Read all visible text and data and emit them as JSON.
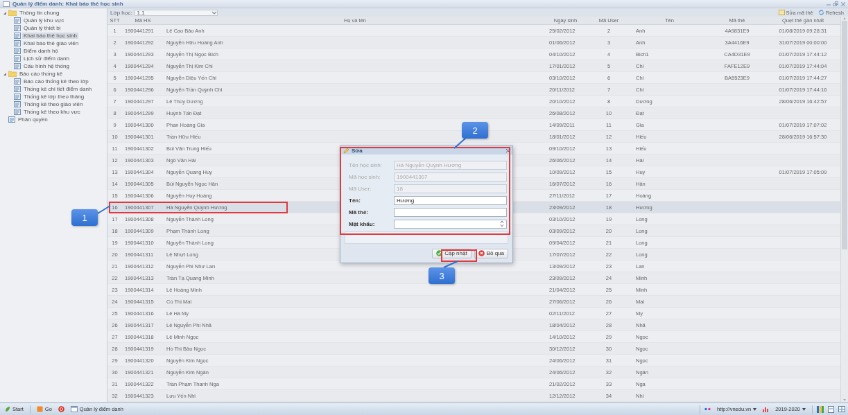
{
  "window": {
    "title": "Quản lý điểm danh: Khai báo thẻ học sinh"
  },
  "sidebar": {
    "items": [
      {
        "label": "Thông tin chung",
        "expanded": true,
        "children": [
          {
            "label": "Quản lý khu vực",
            "selected": false
          },
          {
            "label": "Quản lý thiết bị",
            "selected": false
          },
          {
            "label": "Khai báo thẻ học sinh",
            "selected": true
          },
          {
            "label": "Khai báo thẻ giáo viên",
            "selected": false
          },
          {
            "label": "Điểm danh hộ",
            "selected": false
          },
          {
            "label": "Lịch sử điểm danh",
            "selected": false
          },
          {
            "label": "Cấu hình hệ thống",
            "selected": false
          }
        ]
      },
      {
        "label": "Báo cáo thống kê",
        "expanded": true,
        "children": [
          {
            "label": "Báo cáo thống kê theo lớp",
            "selected": false
          },
          {
            "label": "Thống kê chi tiết điểm danh",
            "selected": false
          },
          {
            "label": "Thống kê lớp theo tháng",
            "selected": false
          },
          {
            "label": "Thống kê theo giáo viên",
            "selected": false
          },
          {
            "label": "Thống kê theo khu vực",
            "selected": false
          }
        ]
      },
      {
        "label": "Phân quyền",
        "selected": false
      }
    ]
  },
  "toolbar": {
    "class_label": "Lớp học:",
    "class_value": "1.1",
    "buttons": [
      {
        "label": "Sửa mã thẻ",
        "kind": "edit"
      },
      {
        "label": "Refresh",
        "kind": "refresh"
      }
    ]
  },
  "table": {
    "columns": [
      "STT",
      "Mã HS",
      "Họ và tên",
      "Ngày sinh",
      "Mã User",
      "Tên",
      "Mã thẻ",
      "Quẹt thẻ gần nhất"
    ],
    "rows": [
      {
        "selected": false,
        "stt": "1",
        "ma_hs": "1900441291",
        "ho_ten": "Lê Cao Bảo Anh",
        "ngay_sinh": "25/02/2012",
        "ma_user": "2",
        "ten": "Anh",
        "ma_the": "4A9831E9",
        "quet": "01/08/2019 09:28:31"
      },
      {
        "selected": false,
        "stt": "2",
        "ma_hs": "1900441292",
        "ho_ten": "Nguyễn Hữu Hoàng Anh",
        "ngay_sinh": "01/06/2012",
        "ma_user": "3",
        "ten": "Anh",
        "ma_the": "3A4416E9",
        "quet": "31/07/2019 00:00:00"
      },
      {
        "selected": false,
        "stt": "3",
        "ma_hs": "1900441293",
        "ho_ten": "Nguyễn Thị Ngọc Bích",
        "ngay_sinh": "04/10/2012",
        "ma_user": "4",
        "ten": "Bich1",
        "ma_the": "CA4D31E9",
        "quet": "01/07/2019 17:44:12"
      },
      {
        "selected": false,
        "stt": "4",
        "ma_hs": "1900441294",
        "ho_ten": "Nguyễn Thị Kim Chi",
        "ngay_sinh": "17/01/2012",
        "ma_user": "5",
        "ten": "Chi",
        "ma_the": "FAFE12E9",
        "quet": "01/07/2019 17:44:04"
      },
      {
        "selected": false,
        "stt": "5",
        "ma_hs": "1900441295",
        "ho_ten": "Nguyễn Diệu Yến Chi",
        "ngay_sinh": "03/10/2012",
        "ma_user": "6",
        "ten": "Chi",
        "ma_the": "BA5523E9",
        "quet": "01/07/2019 17:44:27"
      },
      {
        "selected": false,
        "stt": "6",
        "ma_hs": "1900441296",
        "ho_ten": "Nguyễn Trần Quỳnh Chi",
        "ngay_sinh": "20/11/2012",
        "ma_user": "7",
        "ten": "Chi",
        "quet": "01/07/2019 17:44:16"
      },
      {
        "selected": false,
        "stt": "7",
        "ma_hs": "1900441297",
        "ho_ten": "Lê Thùy Dương",
        "ngay_sinh": "20/10/2012",
        "ma_user": "8",
        "ten": "Dương",
        "quet": "28/06/2019 16:42:57"
      },
      {
        "selected": false,
        "stt": "8",
        "ma_hs": "1900441299",
        "ho_ten": "Huỳnh Tấn Đạt",
        "ngay_sinh": "26/08/2012",
        "ma_user": "10",
        "ten": "Đạt"
      },
      {
        "selected": false,
        "stt": "9",
        "ma_hs": "1900441300",
        "ho_ten": "Phan Hoàng Gia",
        "ngay_sinh": "14/09/2011",
        "ma_user": "11",
        "ten": "Gia",
        "quet": "01/07/2019 17:07:02"
      },
      {
        "selected": false,
        "stt": "10",
        "ma_hs": "1900441301",
        "ho_ten": "Trần Hữu Hiếu",
        "ngay_sinh": "18/01/2012",
        "ma_user": "12",
        "ten": "Hiếu",
        "quet": "28/06/2019 16:57:30"
      },
      {
        "selected": false,
        "stt": "11",
        "ma_hs": "1900441302",
        "ho_ten": "Bùi Văn Trung Hiếu",
        "ngay_sinh": "09/10/2012",
        "ma_user": "13",
        "ten": "Hiếu"
      },
      {
        "selected": false,
        "stt": "12",
        "ma_hs": "1900441303",
        "ho_ten": "Ngô Văn Hải",
        "ngay_sinh": "26/06/2012",
        "ma_user": "14",
        "ten": "Hải"
      },
      {
        "selected": false,
        "stt": "13",
        "ma_hs": "1900441304",
        "ho_ten": "Nguyễn Quang Huy",
        "ngay_sinh": "10/09/2012",
        "ma_user": "15",
        "ten": "Huy",
        "quet": "01/07/2019 17:05:09"
      },
      {
        "selected": false,
        "stt": "14",
        "ma_hs": "1900441305",
        "ho_ten": "Bùi Nguyễn Ngọc Hân",
        "ngay_sinh": "16/07/2012",
        "ma_user": "16",
        "ten": "Hân"
      },
      {
        "selected": false,
        "stt": "15",
        "ma_hs": "1900441306",
        "ho_ten": "Nguyễn Huy Hoàng",
        "ngay_sinh": "27/11/2012",
        "ma_user": "17",
        "ten": "Hoàng"
      },
      {
        "selected": true,
        "stt": "16",
        "ma_hs": "1900441307",
        "ho_ten": "Hà Nguyễn Quỳnh Hương",
        "ngay_sinh": "23/09/2012",
        "ma_user": "18",
        "ten": "Hương"
      },
      {
        "selected": false,
        "stt": "17",
        "ma_hs": "1900441308",
        "ho_ten": "Nguyễn Thành Long",
        "ngay_sinh": "03/10/2012",
        "ma_user": "19",
        "ten": "Long"
      },
      {
        "selected": false,
        "stt": "18",
        "ma_hs": "1900441309",
        "ho_ten": "Phạm Thành Long",
        "ngay_sinh": "03/09/2012",
        "ma_user": "20",
        "ten": "Long"
      },
      {
        "selected": false,
        "stt": "19",
        "ma_hs": "1900441310",
        "ho_ten": "Nguyễn Thành Long",
        "ngay_sinh": "09/04/2012",
        "ma_user": "21",
        "ten": "Long"
      },
      {
        "selected": false,
        "stt": "20",
        "ma_hs": "1900441311",
        "ho_ten": "Lê Nhựt Long",
        "ngay_sinh": "17/07/2012",
        "ma_user": "22",
        "ten": "Long"
      },
      {
        "selected": false,
        "stt": "21",
        "ma_hs": "1900441312",
        "ho_ten": "Nguyễn Phi Như Lan",
        "ngay_sinh": "13/09/2012",
        "ma_user": "23",
        "ten": "Lan"
      },
      {
        "selected": false,
        "stt": "22",
        "ma_hs": "1900441313",
        "ho_ten": "Trần Tạ Quang Minh",
        "ngay_sinh": "23/09/2012",
        "ma_user": "24",
        "ten": "Minh"
      },
      {
        "selected": false,
        "stt": "23",
        "ma_hs": "1900441314",
        "ho_ten": "Lê Hoàng Minh",
        "ngay_sinh": "21/04/2012",
        "ma_user": "25",
        "ten": "Minh"
      },
      {
        "selected": false,
        "stt": "24",
        "ma_hs": "1900441315",
        "ho_ten": "Cù Thị Mai",
        "ngay_sinh": "27/06/2012",
        "ma_user": "26",
        "ten": "Mai"
      },
      {
        "selected": false,
        "stt": "25",
        "ma_hs": "1900441316",
        "ho_ten": "Lê Hà My",
        "ngay_sinh": "02/11/2012",
        "ma_user": "27",
        "ten": "My"
      },
      {
        "selected": false,
        "stt": "26",
        "ma_hs": "1900441317",
        "ho_ten": "Lê Nguyễn Phi Nhã",
        "ngay_sinh": "18/04/2012",
        "ma_user": "28",
        "ten": "Nhã"
      },
      {
        "selected": false,
        "stt": "27",
        "ma_hs": "1900441318",
        "ho_ten": "Lê Minh Ngọc",
        "ngay_sinh": "14/10/2012",
        "ma_user": "29",
        "ten": "Ngọc"
      },
      {
        "selected": false,
        "stt": "28",
        "ma_hs": "1900441319",
        "ho_ten": "Hồ Thị Bảo Ngọc",
        "ngay_sinh": "30/12/2012",
        "ma_user": "30",
        "ten": "Ngọc"
      },
      {
        "selected": false,
        "stt": "29",
        "ma_hs": "1900441320",
        "ho_ten": "Nguyễn Kim Ngọc",
        "ngay_sinh": "24/06/2012",
        "ma_user": "31",
        "ten": "Ngọc"
      },
      {
        "selected": false,
        "stt": "30",
        "ma_hs": "1900441321",
        "ho_ten": "Nguyễn Kim Ngân",
        "ngay_sinh": "24/06/2012",
        "ma_user": "32",
        "ten": "Ngân"
      },
      {
        "selected": false,
        "stt": "31",
        "ma_hs": "1900441322",
        "ho_ten": "Trần Phạm Thanh Nga",
        "ngay_sinh": "21/02/2012",
        "ma_user": "33",
        "ten": "Nga"
      },
      {
        "selected": false,
        "stt": "32",
        "ma_hs": "1900441323",
        "ho_ten": "Lưu Yến Nhi",
        "ngay_sinh": "12/12/2012",
        "ma_user": "34",
        "ten": "Nhi"
      }
    ]
  },
  "dialog": {
    "title": "Sửa",
    "fields": [
      {
        "label": "Tên học sinh:",
        "value": "Hà Nguyễn Quỳnh Hương",
        "disabled": true,
        "kind": "text"
      },
      {
        "label": "Mã học sinh:",
        "value": "1900441307",
        "disabled": true,
        "kind": "text"
      },
      {
        "label": "Mã User:",
        "value": "18",
        "disabled": true,
        "kind": "text"
      },
      {
        "label": "Tên:",
        "value": "Hương",
        "disabled": false,
        "kind": "text"
      },
      {
        "label": "Mã thẻ:",
        "disabled": false,
        "kind": "text"
      },
      {
        "label": "Mật khẩu:",
        "disabled": false,
        "kind": "spinner"
      }
    ],
    "buttons": [
      {
        "label": "Cập nhật",
        "kind": "ok"
      },
      {
        "label": "Bỏ qua",
        "kind": "cancel"
      }
    ]
  },
  "callouts": [
    "1",
    "2",
    "3"
  ],
  "taskbar": {
    "start": "Start",
    "quick": "Go",
    "windows": [
      "Quản lý điểm danh"
    ],
    "tray": [
      "http://vnedu.vn",
      "2019-2020"
    ]
  }
}
